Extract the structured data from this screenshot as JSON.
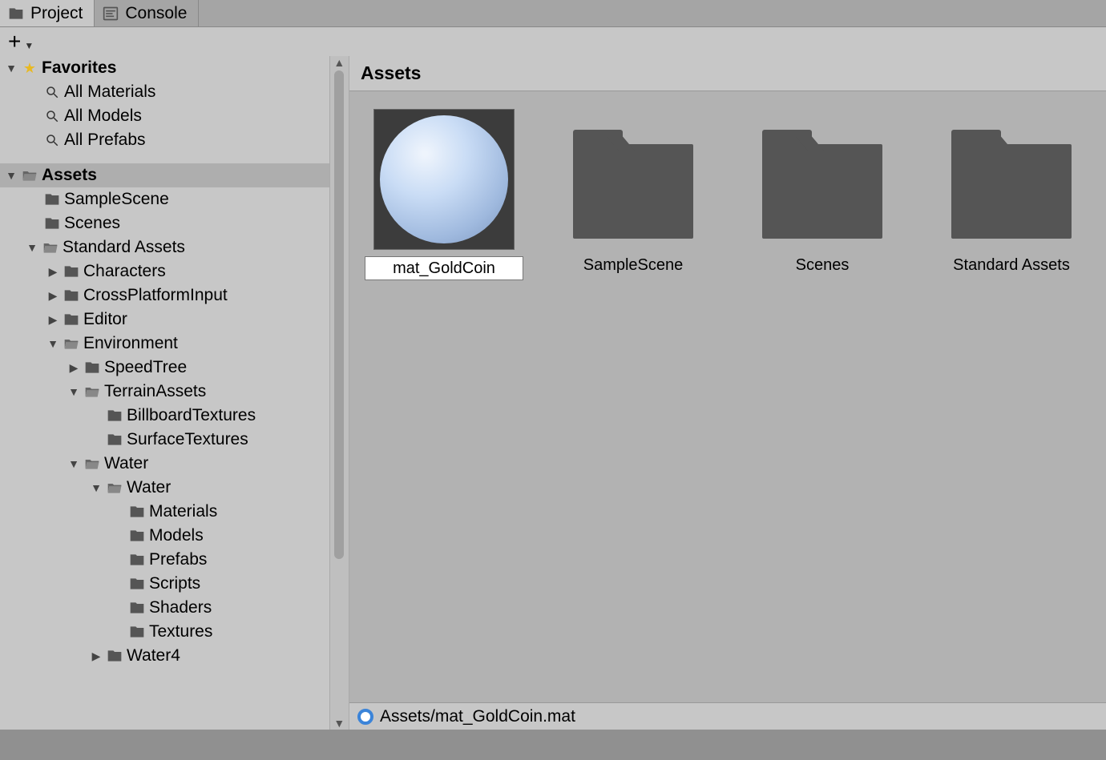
{
  "tabs": {
    "project": "Project",
    "console": "Console"
  },
  "favorites": {
    "header": "Favorites",
    "items": [
      "All Materials",
      "All Models",
      "All Prefabs"
    ]
  },
  "tree": {
    "assets": "Assets",
    "sampleScene": "SampleScene",
    "scenes": "Scenes",
    "standardAssets": "Standard Assets",
    "characters": "Characters",
    "crossPlatform": "CrossPlatformInput",
    "editor": "Editor",
    "environment": "Environment",
    "speedTree": "SpeedTree",
    "terrainAssets": "TerrainAssets",
    "billboardTextures": "BillboardTextures",
    "surfaceTextures": "SurfaceTextures",
    "water": "Water",
    "waterInner": "Water",
    "materials": "Materials",
    "models": "Models",
    "prefabs": "Prefabs",
    "scripts": "Scripts",
    "shaders": "Shaders",
    "textures": "Textures",
    "water4": "Water4"
  },
  "breadcrumb": "Assets",
  "grid": {
    "matGoldCoin": "mat_GoldCoin",
    "sampleScene": "SampleScene",
    "scenes": "Scenes",
    "standardAssets": "Standard Assets"
  },
  "statusPath": "Assets/mat_GoldCoin.mat"
}
